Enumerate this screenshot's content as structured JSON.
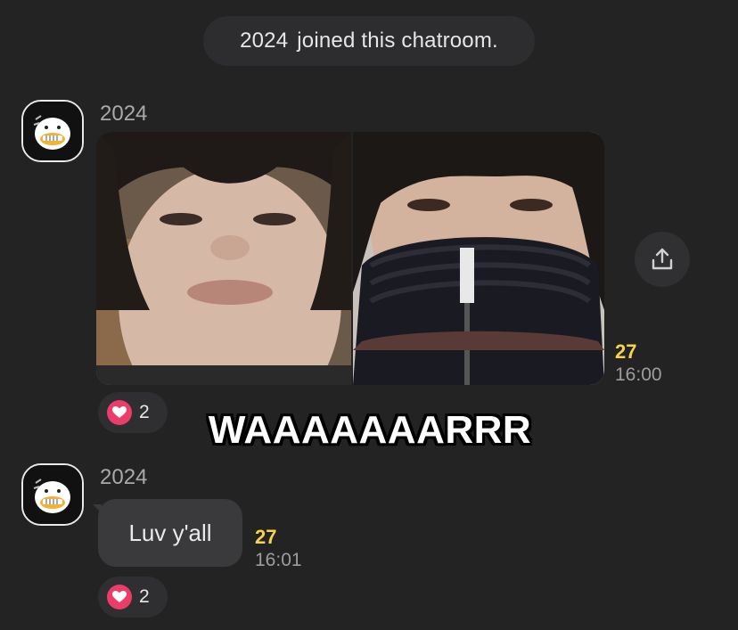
{
  "system_message": {
    "user": "2024",
    "text": "joined this chatroom."
  },
  "messages": [
    {
      "sender": "2024",
      "type": "photo_pair",
      "unread_count": "27",
      "time": "16:00",
      "reaction_count": "2"
    },
    {
      "sender": "2024",
      "type": "text",
      "text": "Luv y'all",
      "unread_count": "27",
      "time": "16:01",
      "reaction_count": "2"
    }
  ],
  "overlay_caption": "WAAAAAAARRR",
  "icons": {
    "share": "share-icon",
    "heart": "heart-icon",
    "avatar": "profile-avatar"
  },
  "colors": {
    "background": "#232324",
    "unread": "#f5d547",
    "heart": "#ec3d6a",
    "bubble": "#3a3a3c"
  }
}
